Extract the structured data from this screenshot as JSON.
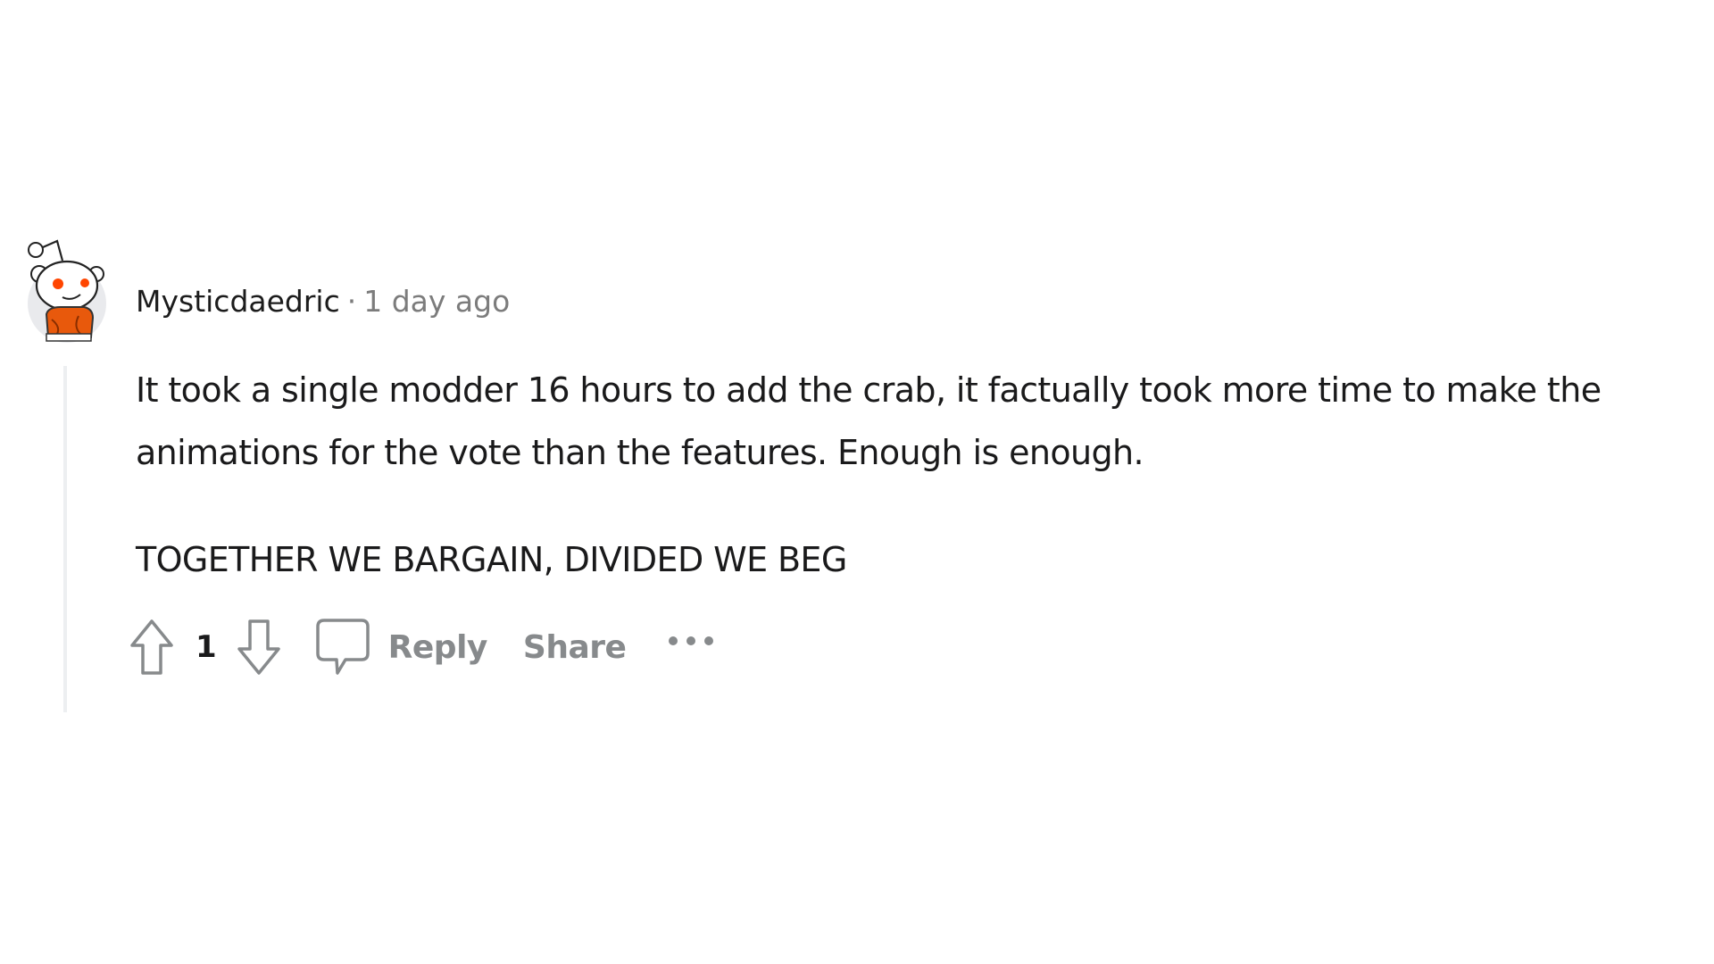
{
  "comment": {
    "author": "Mysticdaedric",
    "separator": "·",
    "timestamp": "1 day ago",
    "body": [
      "It took a single modder 16 hours to add the crab, it factually took more time to make the animations for the vote than the features. Enough is enough.",
      "TOGETHER WE BARGAIN, DIVIDED WE BEG"
    ],
    "avatar_icon": "snoo-avatar-orange-hoodie",
    "actions": {
      "upvote_icon": "arrow-up-icon",
      "vote_count": "1",
      "downvote_icon": "arrow-down-icon",
      "comment_icon": "speech-bubble-icon",
      "reply_label": "Reply",
      "share_label": "Share",
      "more_icon": "ellipsis-icon"
    }
  },
  "colors": {
    "accent_orange": "#ff4500",
    "meta_gray": "#7c7c7c",
    "action_gray": "#878a8c",
    "thread_line": "#edeff1"
  }
}
